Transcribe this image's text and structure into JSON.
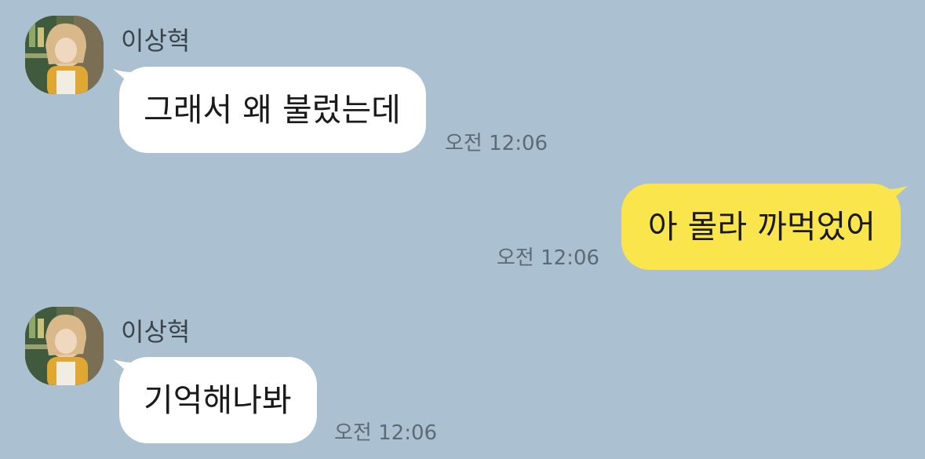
{
  "colors": {
    "background": "#ABC1D1",
    "incoming_bubble": "#FFFFFF",
    "outgoing_bubble": "#FAE64C",
    "timestamp_text": "#5C6A75",
    "name_text": "#3C444B"
  },
  "messages": [
    {
      "direction": "incoming",
      "sender": "이상혁",
      "avatar_icon": "profile-photo",
      "text": "그래서 왜 불렀는데",
      "time": "오전 12:06"
    },
    {
      "direction": "outgoing",
      "text": "아 몰라 까먹었어",
      "time": "오전 12:06"
    },
    {
      "direction": "incoming",
      "sender": "이상혁",
      "avatar_icon": "profile-photo",
      "text": "기억해나봐",
      "time": "오전 12:06"
    }
  ]
}
